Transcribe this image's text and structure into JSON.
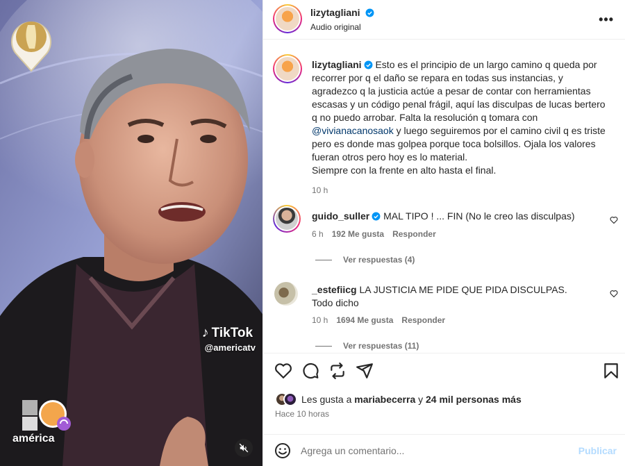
{
  "media": {
    "watermark_brand": "TikTok",
    "watermark_handle": "@americatv",
    "channel_name": "américa"
  },
  "header": {
    "username": "lizytagliani",
    "audio_label": "Audio original",
    "more_icon": "more-horizontal-icon"
  },
  "caption": {
    "username": "lizytagliani",
    "text_before": "Esto es el principio de un largo camino q queda por recorrer por q el daño se repara en todas sus instancias, y agradezco q la justicia actúe a pesar de contar con herramientas escasas y un código penal frágil, aquí las disculpas de lucas bertero q no puedo arrobar. Falta la resolución q tomara con ",
    "mention": "@vivianacanosaok",
    "text_after": " y luego seguiremos por el camino civil q es triste pero es donde mas golpea porque toca bolsillos. Ojala los valores fueran otros pero hoy es lo material.",
    "text_last": "Siempre con la frente en alto hasta el final.",
    "time": "10 h"
  },
  "comments": [
    {
      "username": "guido_suller",
      "text": "MAL TIPO ! ... FIN (No le creo las disculpas)",
      "time": "6 h",
      "likes": "192 Me gusta",
      "reply": "Responder",
      "view_replies": "Ver respuestas (4)"
    },
    {
      "username": "_estefiicg",
      "text": "LA JUSTICIA ME PIDE QUE PIDA DISCULPAS. Todo dicho",
      "time": "10 h",
      "likes": "1694 Me gusta",
      "reply": "Responder",
      "view_replies": "Ver respuestas (11)"
    }
  ],
  "actions": {
    "likes_prefix": "Les gusta a ",
    "likes_user": "mariabecerra",
    "likes_middle": " y ",
    "likes_count": "24 mil personas más",
    "time_ago": "Hace 10 horas"
  },
  "comment_box": {
    "placeholder": "Agrega un comentario...",
    "publish": "Publicar"
  },
  "colors": {
    "link": "#00376b",
    "verified": "#0095f6",
    "publish_disabled": "#b3dbff"
  }
}
